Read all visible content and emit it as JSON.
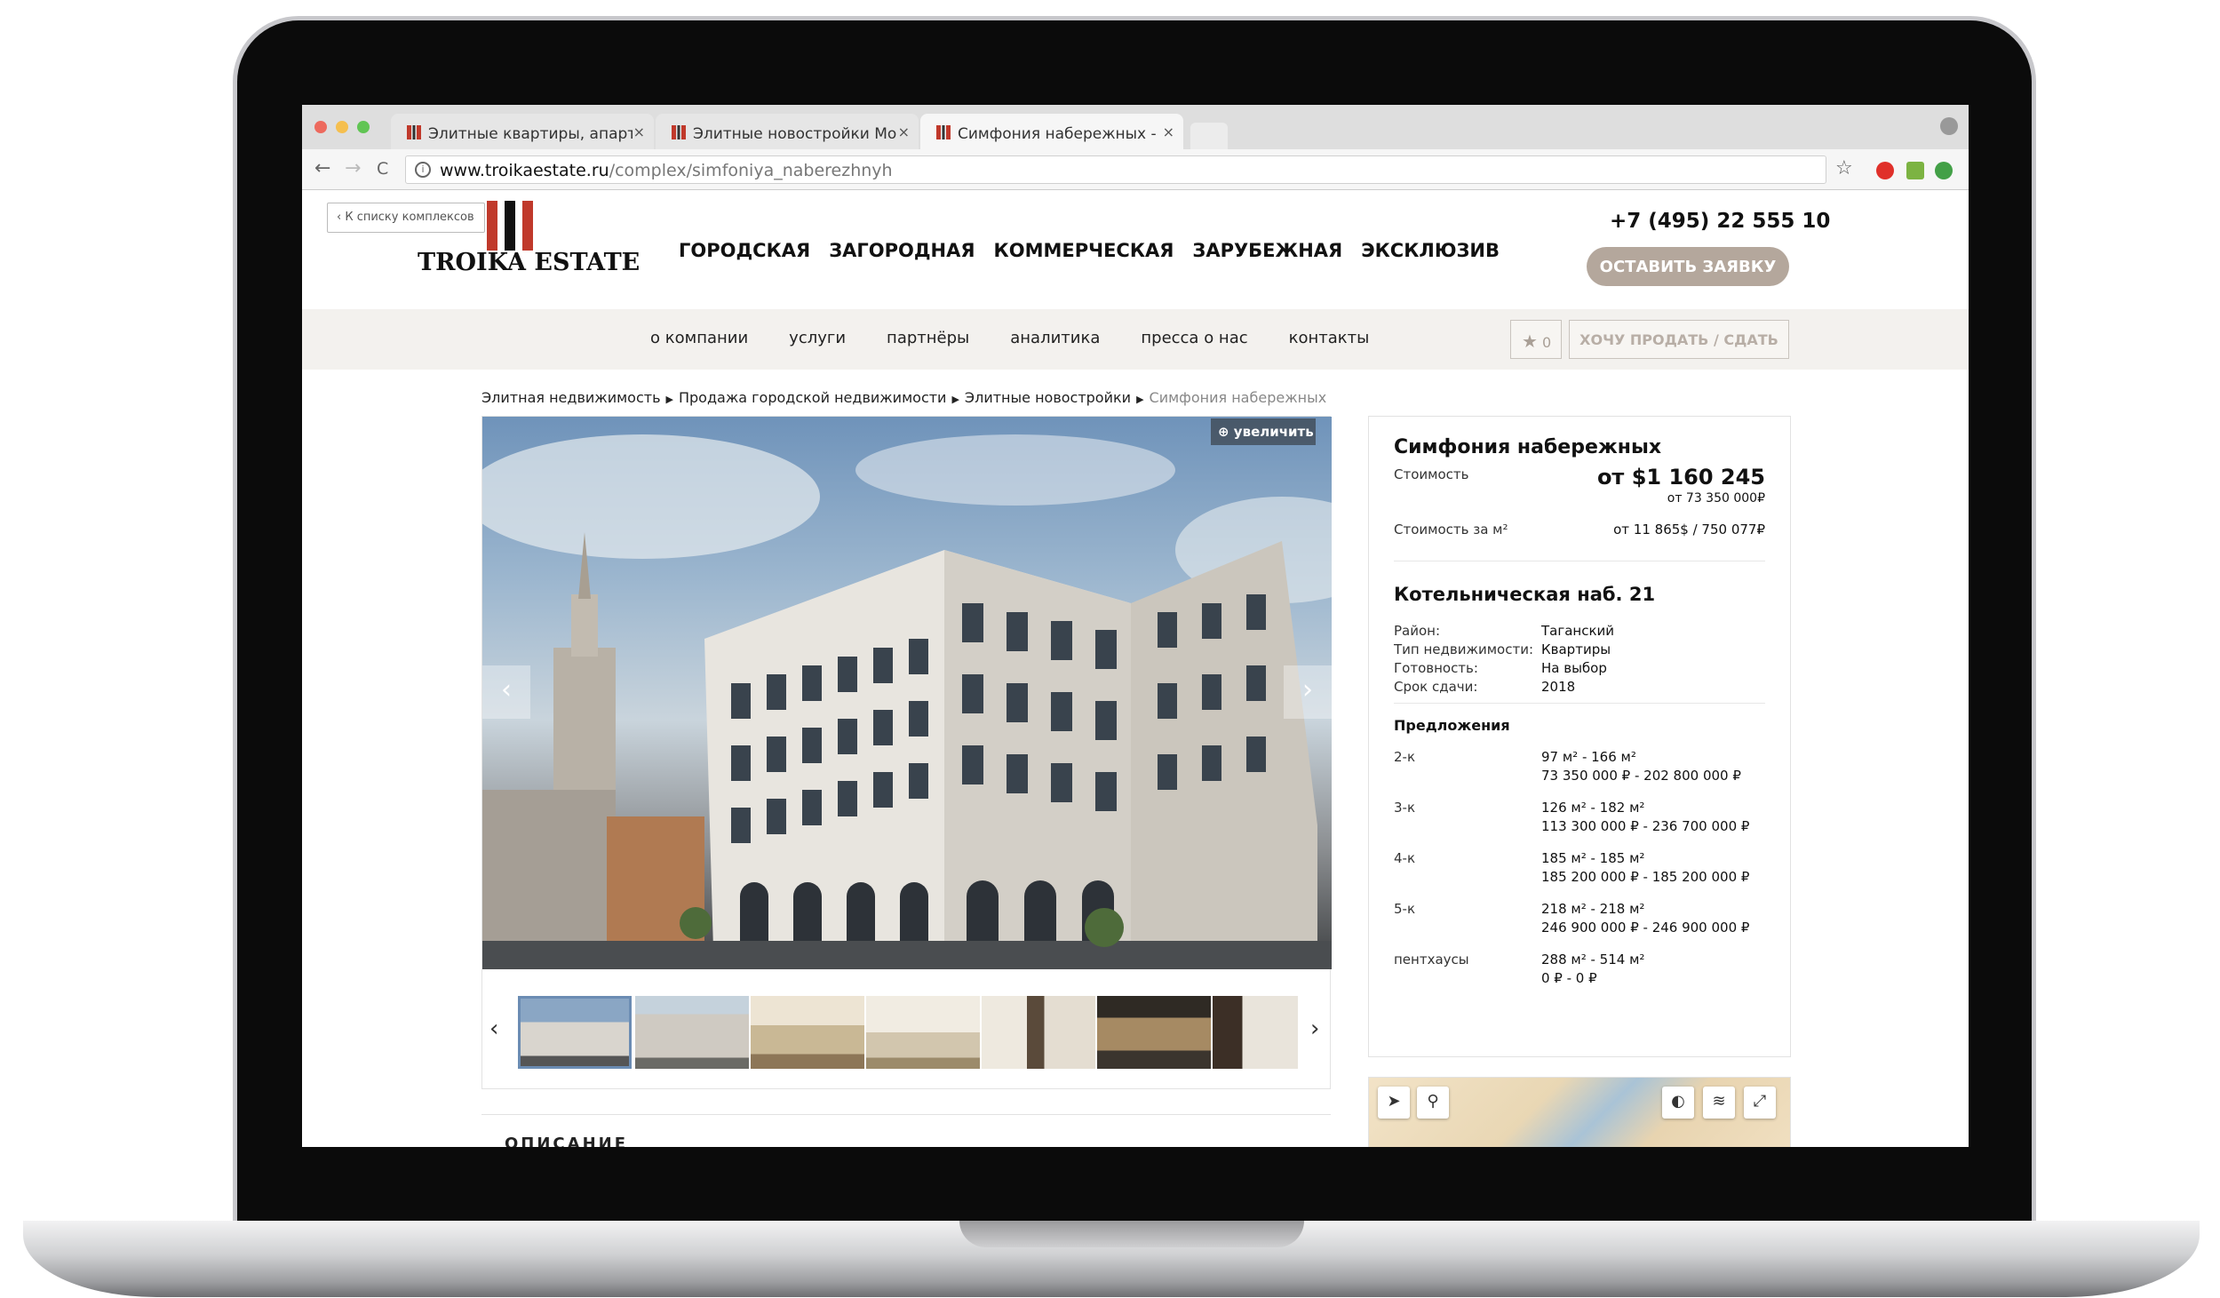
{
  "browser": {
    "tabs": [
      {
        "title": "Элитные квартиры, апартаме"
      },
      {
        "title": "Элитные новостройки Моск"
      },
      {
        "title": "Симфония набережных - куп"
      }
    ],
    "close_glyph": "×",
    "url_host": "www.troikaestate.ru",
    "url_path": "/complex/simfoniya_naberezhnyh",
    "info_glyph": "i",
    "back_glyph": "←",
    "forward_glyph": "→",
    "reload_glyph": "C",
    "star_glyph": "☆"
  },
  "header": {
    "back_link": "‹ К списку комплексов",
    "logo_text": "TROIKA ESTATE",
    "nav": [
      "ГОРОДСКАЯ",
      "ЗАГОРОДНАЯ",
      "КОММЕРЧЕСКАЯ",
      "ЗАРУБЕЖНАЯ",
      "ЭКСКЛЮЗИВ"
    ],
    "phone": "+7 (495) 22 555 10",
    "cta": "ОСТАВИТЬ ЗАЯВКУ"
  },
  "subnav": {
    "items": [
      "о компании",
      "услуги",
      "партнёры",
      "аналитика",
      "пресса о нас",
      "контакты"
    ],
    "favorites_count": "0",
    "star_glyph": "★",
    "sell_button": "ХОЧУ ПРОДАТЬ / СДАТЬ"
  },
  "breadcrumbs": {
    "items": [
      "Элитная недвижимость",
      "Продажа городской недвижимости",
      "Элитные новостройки"
    ],
    "current": "Симфония набережных",
    "sep": "▶"
  },
  "gallery": {
    "zoom_label": "увеличить",
    "prev_glyph": "‹",
    "next_glyph": "›"
  },
  "property": {
    "name": "Симфония набережных",
    "price_label": "Стоимость",
    "price_usd": "от $1 160 245",
    "price_rub": "от 73 350 000₽",
    "price_m2_label": "Стоимость за м²",
    "price_m2": "от 11 865$ / 750 077₽",
    "address": "Котельническая наб. 21",
    "details": [
      {
        "label": "Район:",
        "value": "Таганский"
      },
      {
        "label": "Тип недвижимости:",
        "value": "Квартиры"
      },
      {
        "label": "Готовность:",
        "value": "На выбор"
      },
      {
        "label": "Срок сдачи:",
        "value": "2018"
      }
    ],
    "offers_title": "Предложения",
    "offers": [
      {
        "type": "2-к",
        "area": "97 м² - 166 м²",
        "price": "73 350 000 ₽ - 202 800 000 ₽"
      },
      {
        "type": "3-к",
        "area": "126 м² - 182 м²",
        "price": "113 300 000 ₽ - 236 700 000 ₽"
      },
      {
        "type": "4-к",
        "area": "185 м² - 185 м²",
        "price": "185 200 000 ₽ - 185 200 000 ₽"
      },
      {
        "type": "5-к",
        "area": "218 м² - 218 м²",
        "price": "246 900 000 ₽ - 246 900 000 ₽"
      },
      {
        "type": "пентхаусы",
        "area": "288 м² - 514 м²",
        "price": "0 ₽ - 0 ₽"
      }
    ]
  },
  "description": {
    "heading": "ОПИСАНИЕ"
  },
  "colors": {
    "accent": "#b4a79c",
    "logo_red": "#c0392b",
    "subnav_bg": "#f3f1ee"
  },
  "icons": [
    "star-icon",
    "search-icon",
    "locate-icon",
    "layers-icon",
    "fullscreen-icon"
  ]
}
